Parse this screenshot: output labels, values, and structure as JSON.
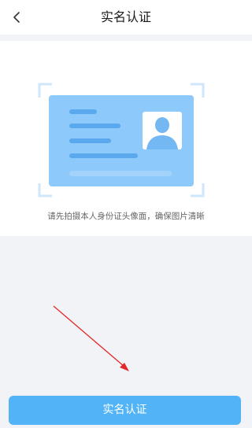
{
  "nav": {
    "back_icon": "chevron-left-icon",
    "title": "实名认证"
  },
  "card": {
    "tip": "请先拍摄本人身份证头像面，确保图片清晰",
    "colors": {
      "card": "#8dc9fb",
      "bracket": "#cfe6fb",
      "avatar_bg": "#ffffff",
      "avatar": "#73b7f3",
      "text_line": "#5aa9ee"
    }
  },
  "action": {
    "submit_label": "实名认证",
    "accent": "#52b4f6"
  },
  "annotation": {
    "arrow_color": "#e02a2a"
  }
}
